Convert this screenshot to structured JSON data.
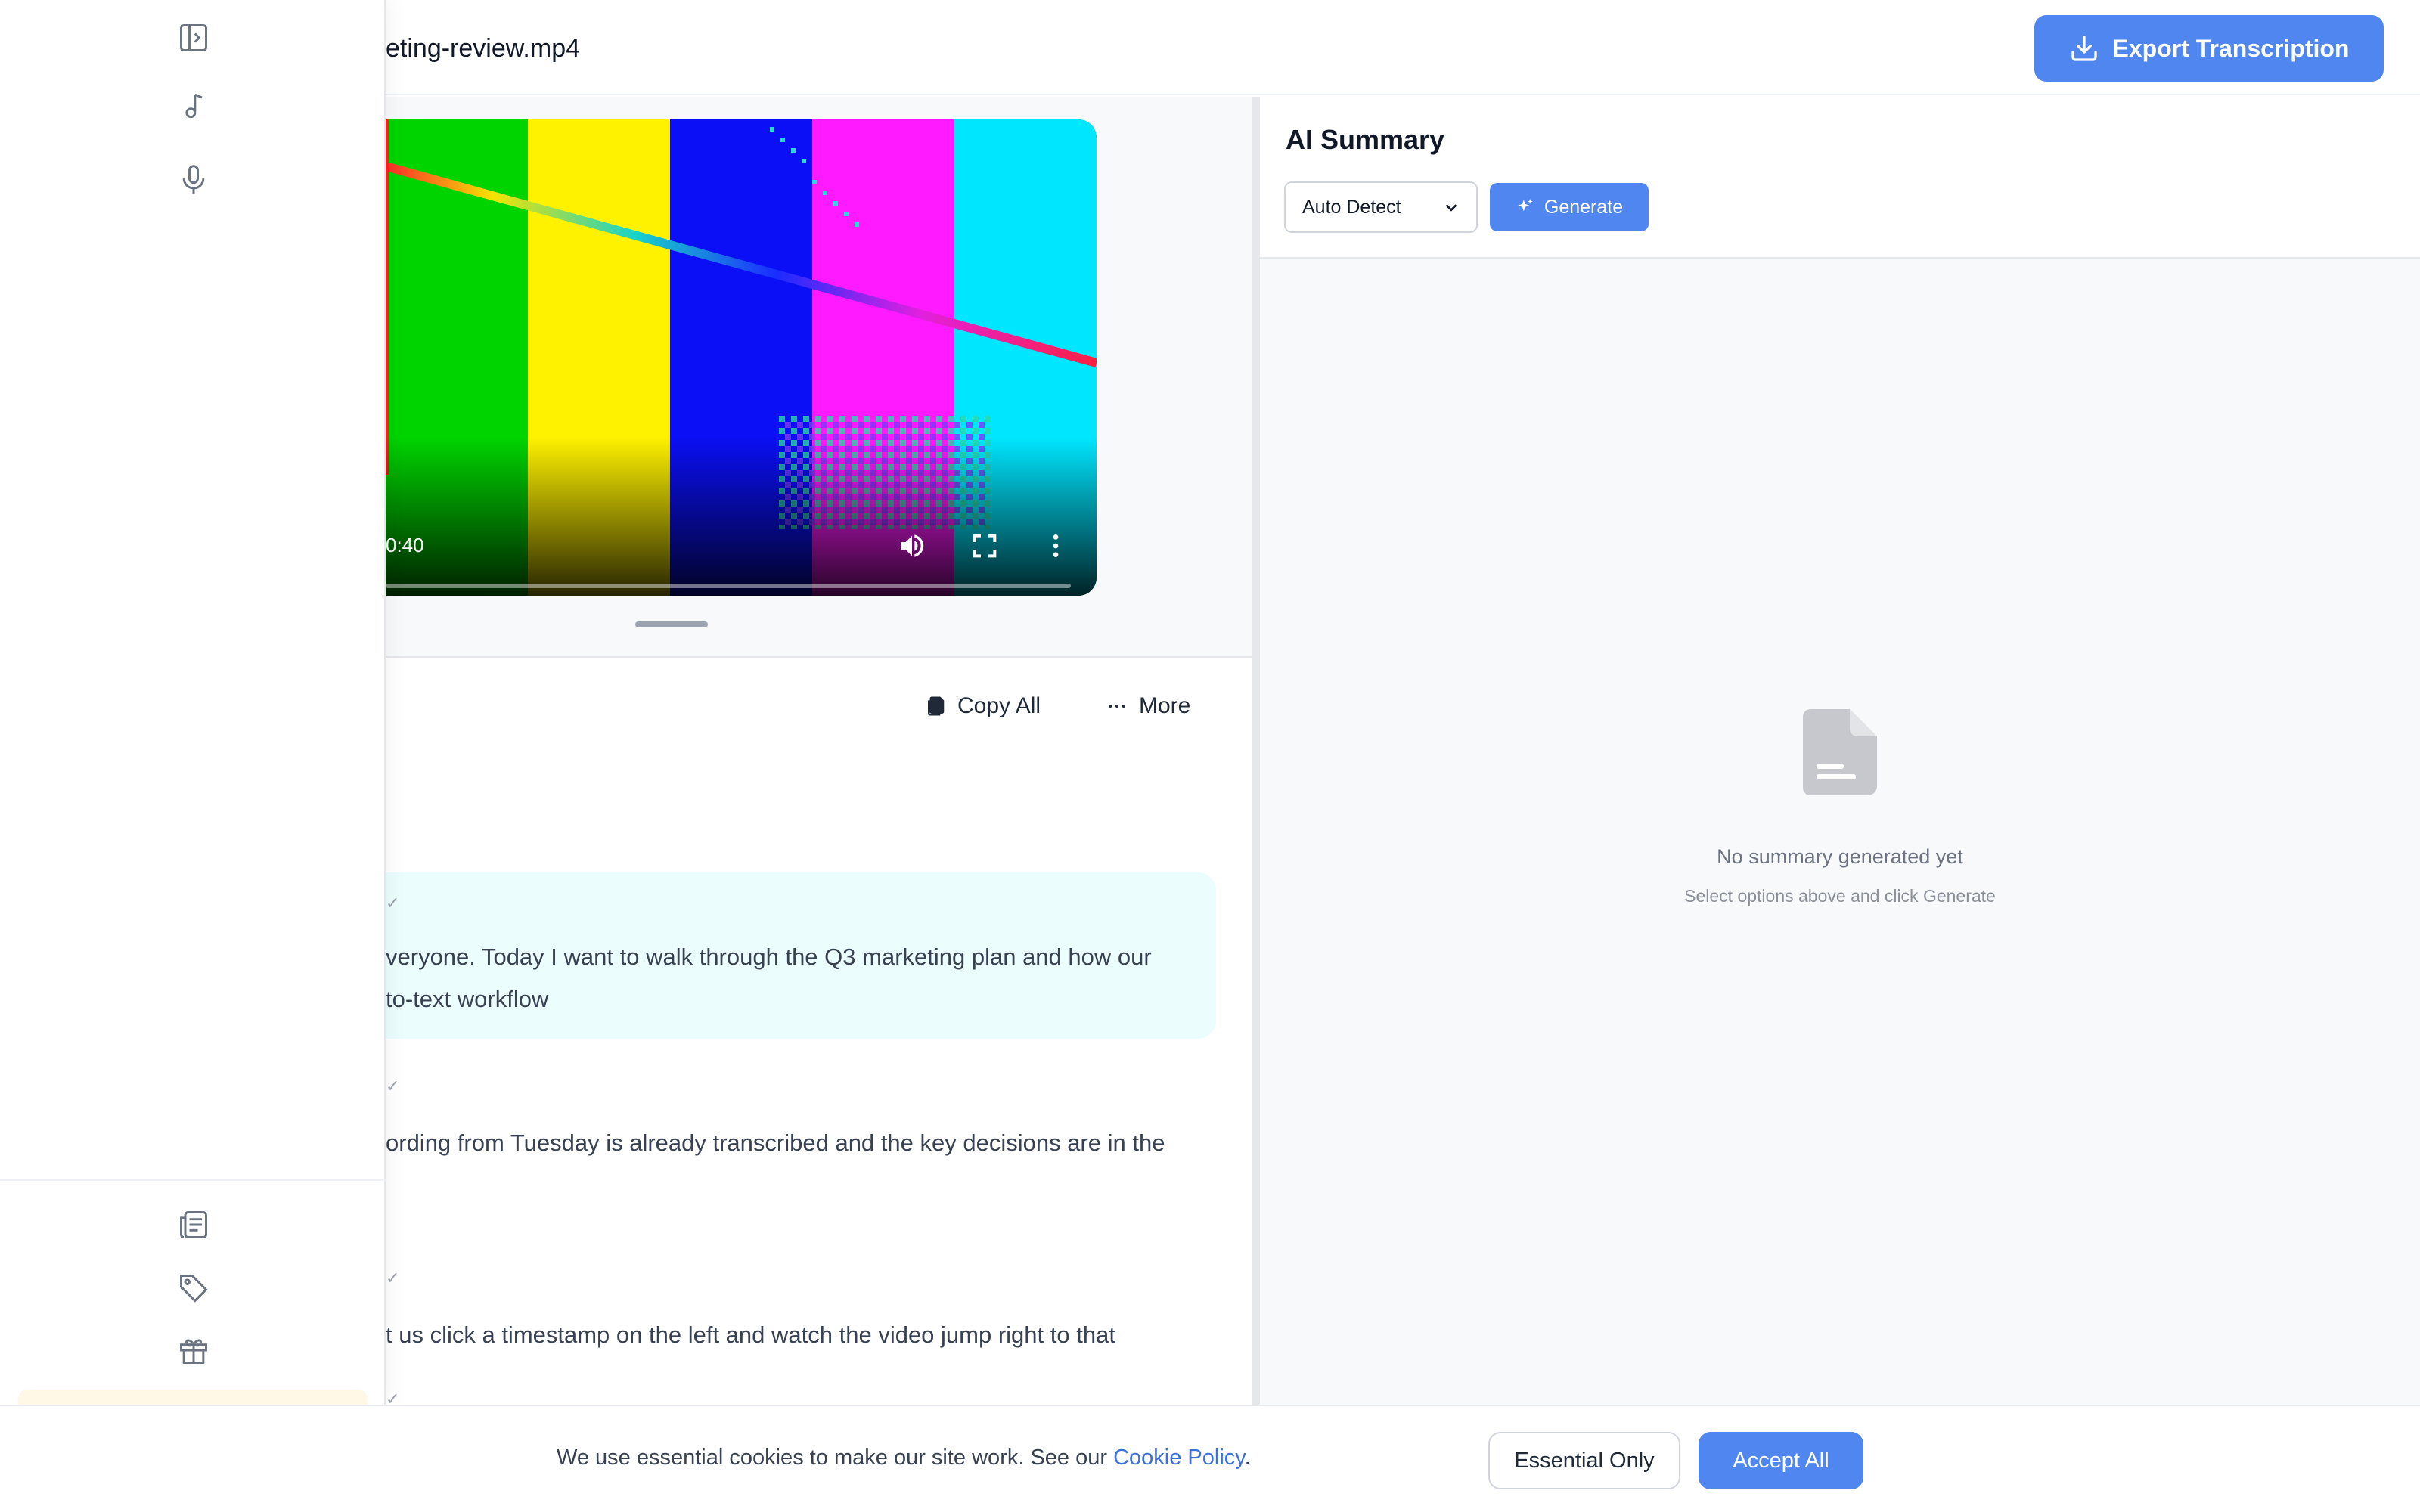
{
  "header": {
    "file_title": "eting-review.mp4",
    "export_label": "Export Transcription"
  },
  "video": {
    "time_display": "0:40",
    "bar_colors": [
      "#00d400",
      "#fff200",
      "#0a0ff5",
      "#ff1aff",
      "#00e6ff"
    ]
  },
  "transcript": {
    "copy_all_label": "Copy All",
    "more_label": "More",
    "segments": [
      {
        "meta": "✓",
        "line1": "veryone. Today I want to walk through the Q3 marketing plan and how our",
        "line2": "to-text workflow"
      },
      {
        "meta": "✓",
        "line1": "ording from Tuesday is already transcribed and the key decisions are in the",
        "line2": ""
      },
      {
        "meta": "✓",
        "line1": "t us click a timestamp on the left and watch the video jump right to that",
        "line2": ""
      },
      {
        "meta": "✓",
        "line1": "",
        "line2": ""
      }
    ]
  },
  "summary": {
    "title": "AI Summary",
    "language_selected": "Auto Detect",
    "generate_label": "Generate",
    "empty_title": "No summary generated yet",
    "empty_subtitle": "Select options above and click Generate"
  },
  "sidebar": {
    "icons": [
      "sidebar-toggle-icon",
      "music-note-icon",
      "microphone-icon",
      "newspaper-icon",
      "tag-icon",
      "gift-icon"
    ]
  },
  "cookie": {
    "text": "We use essential cookies to make our site work. See our ",
    "link_label": "Cookie Policy",
    "text_end": ".",
    "essential_label": "Essential Only",
    "accept_label": "Accept All"
  },
  "colors": {
    "accent": "#4f86f0",
    "highlight_segment": "#ecfdfe"
  }
}
